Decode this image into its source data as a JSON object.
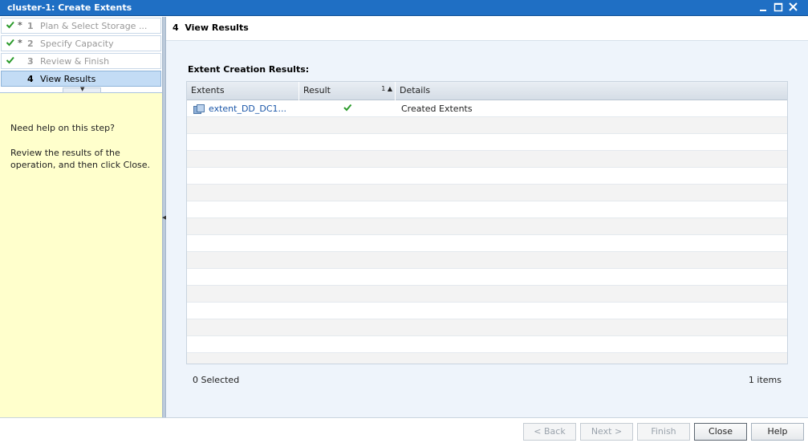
{
  "window": {
    "title": "cluster-1: Create Extents",
    "controls": [
      "minimize-icon",
      "maximize-icon",
      "close-icon"
    ]
  },
  "wizard": {
    "steps": [
      {
        "num": "1",
        "label": "Plan & Select Storage ...",
        "completed": true,
        "required": true,
        "active": false
      },
      {
        "num": "2",
        "label": "Specify Capacity",
        "completed": true,
        "required": true,
        "active": false
      },
      {
        "num": "3",
        "label": "Review & Finish",
        "completed": true,
        "required": false,
        "active": false
      },
      {
        "num": "4",
        "label": "View Results",
        "completed": false,
        "required": false,
        "active": true
      }
    ],
    "required_marker": "*"
  },
  "help": {
    "question": "Need help on this step?",
    "text": "Review the results of the operation, and then click Close."
  },
  "main": {
    "header_num": "4",
    "header_title": "View Results",
    "section_title": "Extent Creation Results:"
  },
  "table": {
    "columns": {
      "extents": "Extents",
      "result": "Result",
      "details": "Details"
    },
    "sort": {
      "column": "result",
      "order": "1",
      "direction": "ascending"
    },
    "rows": [
      {
        "extent": "extent_DD_DC1...",
        "result": "success",
        "details": "Created Extents"
      }
    ]
  },
  "footer": {
    "selected": "0 Selected",
    "items": "1 items"
  },
  "buttons": {
    "back": "< Back",
    "next": "Next >",
    "finish": "Finish",
    "close": "Close",
    "help": "Help"
  },
  "colors": {
    "titlebar": "#1f6fc4",
    "check": "#2a9a2a",
    "link": "#1a56a8",
    "help_bg": "#ffffcc"
  }
}
